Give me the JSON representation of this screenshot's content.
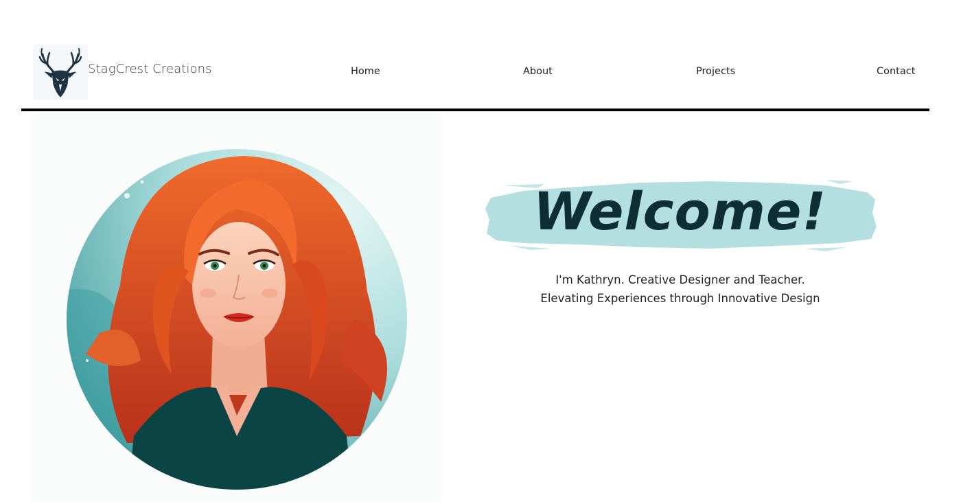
{
  "header": {
    "brand": "StagCrest Creations",
    "logo_icon": "stag-head-icon",
    "nav": [
      {
        "label": "Home"
      },
      {
        "label": "About"
      },
      {
        "label": "Projects"
      },
      {
        "label": "Contact"
      }
    ]
  },
  "hero": {
    "image": "illustrated-portrait-red-haired-woman",
    "welcome": "Welcome!",
    "tagline_line1": "I'm Kathryn. Creative Designer and Teacher.",
    "tagline_line2": "Elevating Experiences through Innovative Design"
  },
  "colors": {
    "banner_brush": "#b4dfe0",
    "welcome_text": "#0d2e35",
    "divider": "#000000",
    "portrait_bg": "#6fc3c4",
    "hair": "#e25822",
    "top": "#0b4445"
  }
}
